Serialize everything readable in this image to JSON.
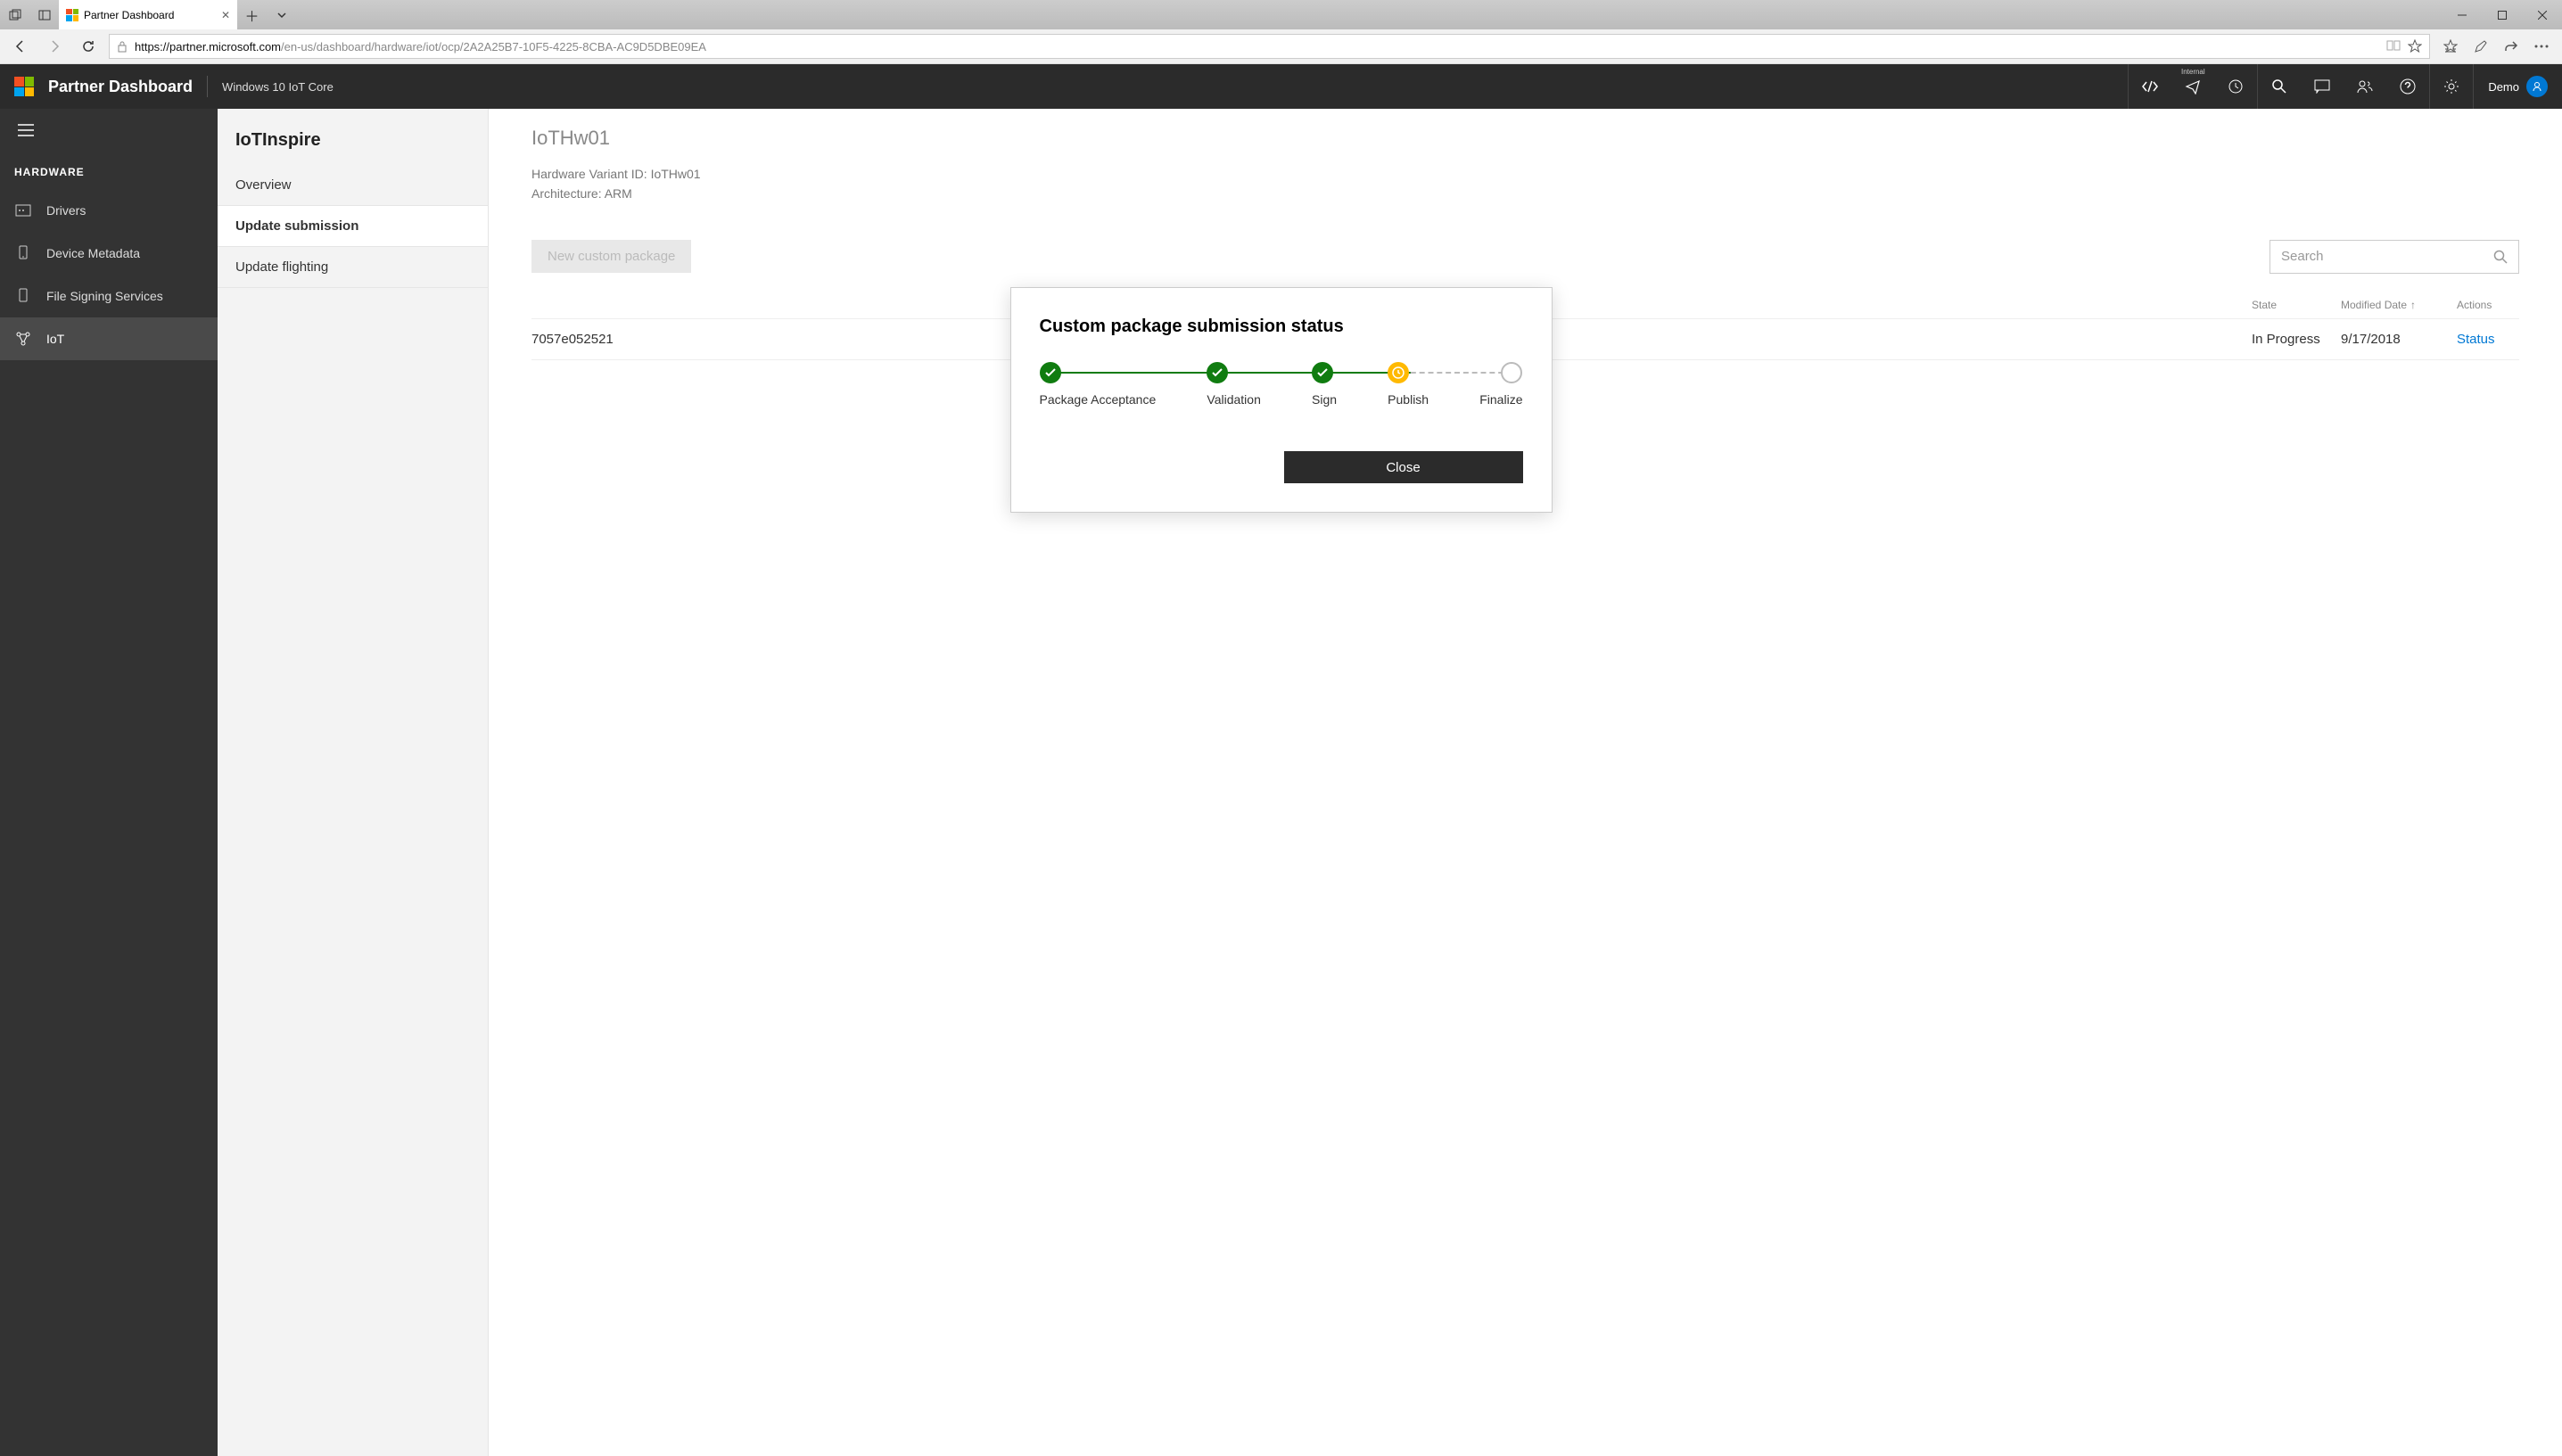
{
  "browser": {
    "tab_title": "Partner Dashboard",
    "url_host": "https://partner.microsoft.com",
    "url_path": "/en-us/dashboard/hardware/iot/ocp/2A2A25B7-10F5-4225-8CBA-AC9D5DBE09EA"
  },
  "header": {
    "title": "Partner Dashboard",
    "subtitle": "Windows 10 IoT Core",
    "internal_label": "Internal",
    "user_name": "Demo"
  },
  "sidebar": {
    "heading": "HARDWARE",
    "items": [
      {
        "label": "Drivers"
      },
      {
        "label": "Device Metadata"
      },
      {
        "label": "File Signing Services"
      },
      {
        "label": "IoT"
      }
    ]
  },
  "panel": {
    "title": "IoTInspire",
    "items": [
      {
        "label": "Overview"
      },
      {
        "label": "Update submission"
      },
      {
        "label": "Update flighting"
      }
    ]
  },
  "main": {
    "title": "IoTHw01",
    "hw_variant_label": "Hardware Variant ID: IoTHw01",
    "architecture_label": "Architecture: ARM",
    "new_package_btn": "New custom package",
    "search_placeholder": "Search",
    "columns": {
      "state": "State",
      "modified": "Modified Date",
      "actions": "Actions"
    },
    "row": {
      "id": "7057e052521",
      "state": "In Progress",
      "date": "9/17/2018",
      "action": "Status"
    }
  },
  "modal": {
    "title": "Custom package submission status",
    "steps": [
      {
        "label": "Package Acceptance",
        "state": "done"
      },
      {
        "label": "Validation",
        "state": "done"
      },
      {
        "label": "Sign",
        "state": "done"
      },
      {
        "label": "Publish",
        "state": "progress"
      },
      {
        "label": "Finalize",
        "state": "empty"
      }
    ],
    "close_btn": "Close"
  }
}
